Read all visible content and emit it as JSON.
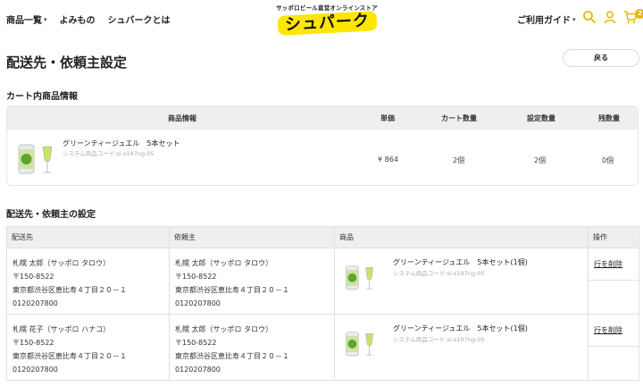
{
  "header": {
    "nav": [
      {
        "label": "商品一覧",
        "has_caret": true
      },
      {
        "label": "よみもの",
        "has_caret": false
      },
      {
        "label": "シュバークとは",
        "has_caret": false
      }
    ],
    "logo_tagline": "サッポロビール直営オンラインストア",
    "logo_text": "シュパーク",
    "guide_label": "ご利用ガイド",
    "cart_count": "2",
    "accent_color": "#e9b800"
  },
  "page": {
    "title": "配送先・依頼主設定",
    "back_label": "戻る"
  },
  "cart_section": {
    "title": "カート内商品情報",
    "headers": {
      "product": "商品情報",
      "price": "単価",
      "cart_qty": "カート数量",
      "set_qty": "設定数量",
      "remaining": "残数量"
    },
    "item": {
      "name": "グリーンティージュエル　5本セット",
      "code": "システム商品コード:si-s197ng-05",
      "price": "¥ 864",
      "cart_qty": "2個",
      "set_qty": "2個",
      "remaining": "0個"
    }
  },
  "dest_section": {
    "title": "配送先・依頼主の設定",
    "headers": {
      "dest": "配送先",
      "sender": "依頼主",
      "product": "商品",
      "op": "操作"
    },
    "rows": [
      {
        "dest": {
          "name": "札幌 太郎（サッポロ タロウ）",
          "zip": "〒150-8522",
          "address": "東京都渋谷区恵比寿４丁目２０－１",
          "tel": "0120207800"
        },
        "sender": {
          "name": "札幌 太郎（サッポロ タロウ）",
          "zip": "〒150-8522",
          "address": "東京都渋谷区恵比寿４丁目２０－１",
          "tel": "0120207800"
        },
        "product_name": "グリーンティージュエル　5本セット(1個)",
        "product_code": "システム商品コード:si-s197ng-05",
        "delete_label": "行を削除"
      },
      {
        "dest": {
          "name": "札幌 花子（サッポロ ハナコ）",
          "zip": "〒150-8522",
          "address": "東京都渋谷区恵比寿４丁目２０－１",
          "tel": "0120207800"
        },
        "sender": {
          "name": "札幌 太郎（サッポロ タロウ）",
          "zip": "〒150-8522",
          "address": "東京都渋谷区恵比寿４丁目２０－１",
          "tel": "0120207800"
        },
        "product_name": "グリーンティージュエル　5本セット(1個)",
        "product_code": "システム商品コード:si-s197ng-05",
        "delete_label": "行を削除"
      }
    ]
  }
}
